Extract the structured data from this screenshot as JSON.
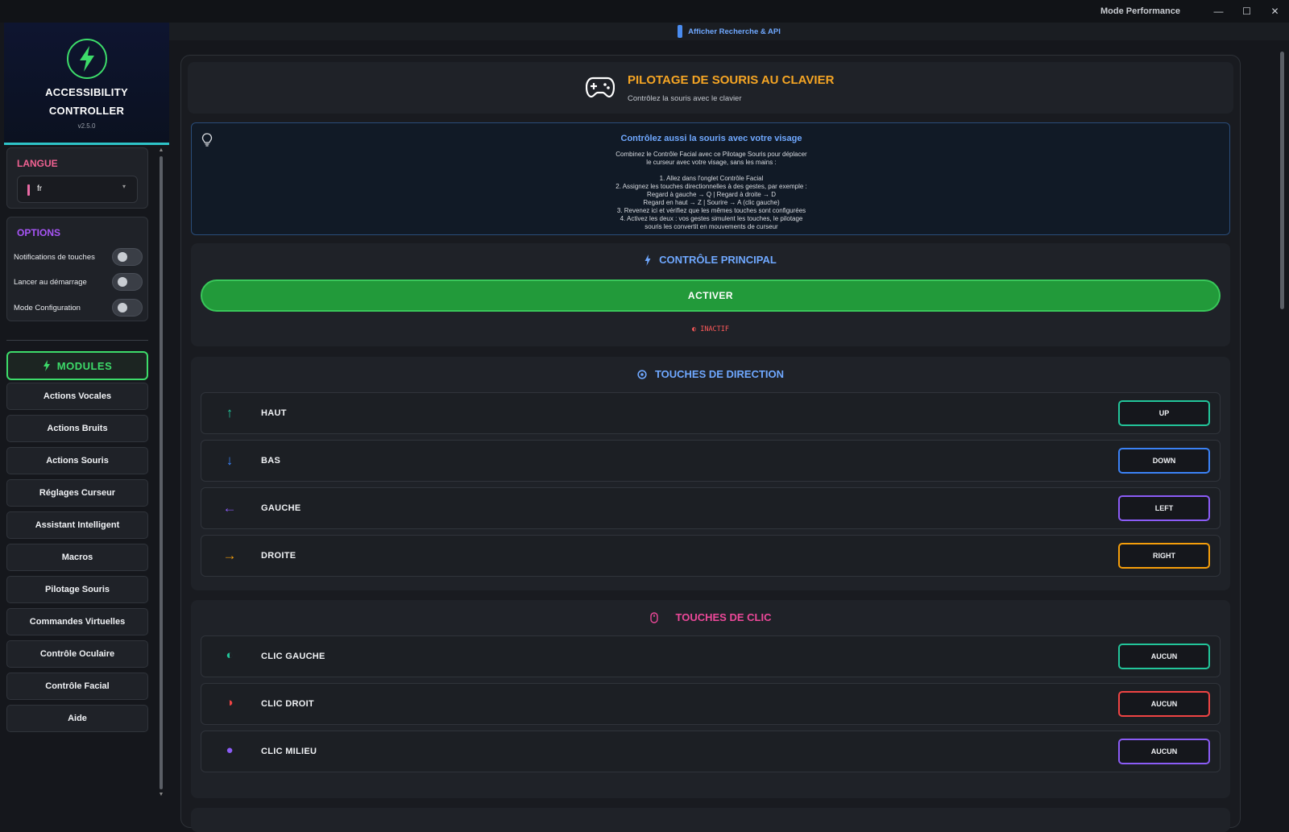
{
  "window": {
    "mode_label": "Mode Performance",
    "controls": {
      "minimize": "—",
      "maximize": "☐",
      "close": "✕"
    }
  },
  "logo": {
    "title_line1": "ACCESSIBILITY",
    "title_line2": "CONTROLLER",
    "version": "v2.5.0",
    "icon": "lightning-icon"
  },
  "sidebar": {
    "language": {
      "title": "LANGUE",
      "value": "fr",
      "title_color": "#f06292"
    },
    "options": {
      "title": "OPTIONS",
      "title_color": "#a855f7",
      "items": [
        {
          "label": "Notifications de touches",
          "on": false
        },
        {
          "label": "Lancer au démarrage",
          "on": false
        },
        {
          "label": "Mode Configuration",
          "on": false
        }
      ]
    },
    "modules_label": "MODULES",
    "nav": [
      "Actions Vocales",
      "Actions Bruits",
      "Actions Souris",
      "Réglages Curseur",
      "Assistant Intelligent",
      "Macros",
      "Pilotage Souris",
      "Commandes Virtuelles",
      "Contrôle Oculaire",
      "Contrôle Facial",
      "Aide"
    ]
  },
  "topbar": {
    "label": "Afficher Recherche & API"
  },
  "header": {
    "title": "PILOTAGE DE SOURIS AU CLAVIER",
    "subtitle": "Contrôlez la souris avec le clavier",
    "icon": "gamepad-icon"
  },
  "info": {
    "title": "Contrôlez aussi la souris avec votre visage",
    "lines": [
      "Combinez le Contrôle Facial avec ce Pilotage Souris pour déplacer",
      "le curseur avec votre visage, sans les mains :",
      "",
      "1. Allez dans l'onglet Contrôle Facial",
      "2. Assignez les touches directionnelles à des gestes, par exemple :",
      "Regard à gauche → Q  |  Regard à droite → D",
      "Regard en haut → Z  |  Sourire → A (clic gauche)",
      "3. Revenez ici et vérifiez que les mêmes touches sont configurées",
      "4. Activez les deux : vos gestes simulent les touches, le pilotage",
      "souris les convertit en mouvements de curseur"
    ]
  },
  "main_control": {
    "title": "CONTRÔLE PRINCIPAL",
    "button": "ACTIVER",
    "status": "◐ INACTIF"
  },
  "direction": {
    "title": "TOUCHES DE DIRECTION",
    "rows": [
      {
        "icon": "↑",
        "icon_name": "arrow-up-icon",
        "name": "HAUT",
        "key": "UP",
        "color": "#22c59a"
      },
      {
        "icon": "↓",
        "icon_name": "arrow-down-icon",
        "name": "BAS",
        "key": "DOWN",
        "color": "#3b82f6"
      },
      {
        "icon": "←",
        "icon_name": "arrow-left-icon",
        "name": "GAUCHE",
        "key": "LEFT",
        "color": "#8b5cf6"
      },
      {
        "icon": "→",
        "icon_name": "arrow-right-icon",
        "name": "DROITE",
        "key": "RIGHT",
        "color": "#f59e0b"
      }
    ]
  },
  "click": {
    "title": "TOUCHES DE CLIC",
    "rows": [
      {
        "icon": "◐",
        "icon_name": "left-half-circle-icon",
        "name": "CLIC GAUCHE",
        "key": "AUCUN",
        "color": "#22c59a"
      },
      {
        "icon": "◑",
        "icon_name": "right-half-circle-icon",
        "name": "CLIC DROIT",
        "key": "AUCUN",
        "color": "#ef4444"
      },
      {
        "icon": "●",
        "icon_name": "full-circle-icon",
        "name": "CLIC MILIEU",
        "key": "AUCUN",
        "color": "#8b5cf6"
      }
    ]
  }
}
